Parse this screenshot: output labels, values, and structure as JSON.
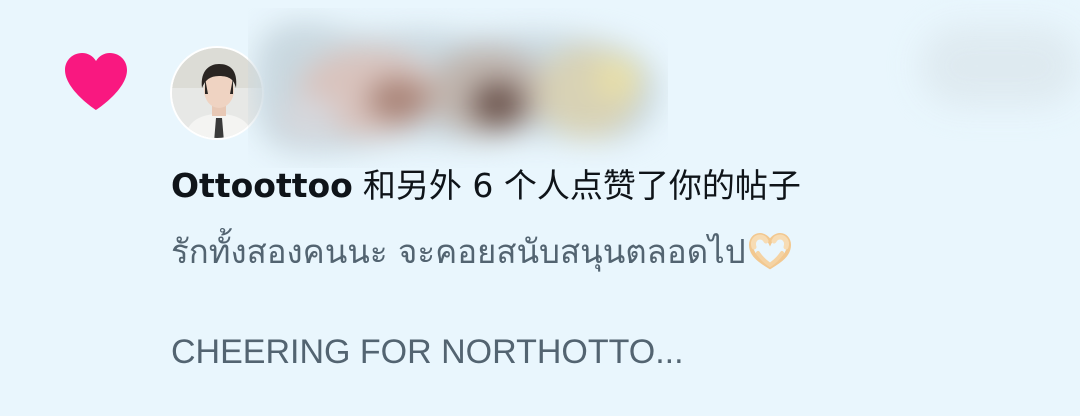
{
  "notification": {
    "type_icon": "heart-icon",
    "heart_color": "#f91880",
    "username": "Ottoottoo",
    "action_text": "和另外 6 个人点赞了你的帖子",
    "post_text_line1": "รักทั้งสองคนนะ จะคอยสนับสนุนตลอดไป",
    "post_emoji": "heart-hands-emoji",
    "post_text_line2": "CHEERING FOR NORTHOTTO..."
  },
  "colors": {
    "background": "#e9f6fd",
    "primary_text": "#0f1419",
    "secondary_text": "#536471"
  }
}
